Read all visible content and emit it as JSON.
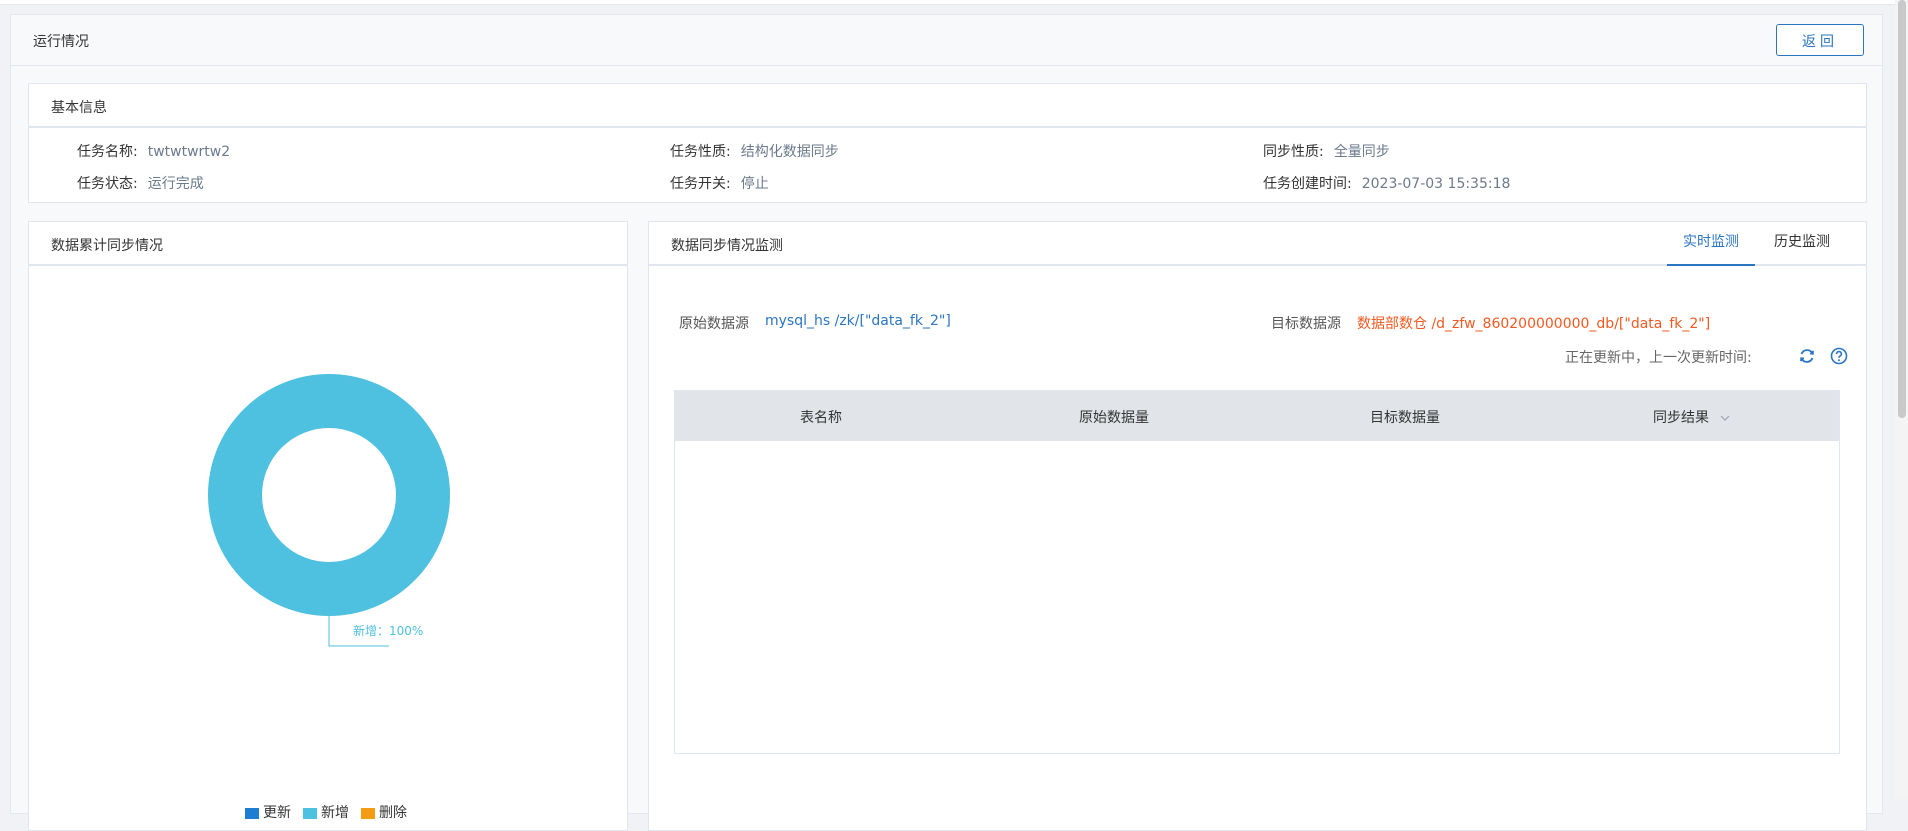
{
  "page": {
    "title": "运行情况",
    "back_label": "返回"
  },
  "basic_info": {
    "title": "基本信息",
    "fields": [
      {
        "label": "任务名称:",
        "value": "twtwtwrtw2"
      },
      {
        "label": "任务性质:",
        "value": "结构化数据同步"
      },
      {
        "label": "同步性质:",
        "value": "全量同步"
      },
      {
        "label": "任务状态:",
        "value": "运行完成"
      },
      {
        "label": "任务开关:",
        "value": "停止"
      },
      {
        "label": "任务创建时间:",
        "value": "2023-07-03 15:35:18"
      }
    ]
  },
  "left_panel": {
    "title": "数据累计同步情况"
  },
  "chart_data": {
    "type": "pie",
    "categories": [
      "更新",
      "新增",
      "删除"
    ],
    "values": [
      0,
      100,
      0
    ],
    "colors": [
      "#1f7dd1",
      "#4ec0e0",
      "#f59b14"
    ],
    "data_label": "新增：100%",
    "legend_position": "bottom"
  },
  "right_panel": {
    "title": "数据同步情况监测",
    "tabs": [
      {
        "label": "实时监测",
        "active": true
      },
      {
        "label": "历史监测",
        "active": false
      }
    ],
    "source_label": "原始数据源",
    "source_value": "mysql_hs /zk/[\"data_fk_2\"]",
    "target_label": "目标数据源",
    "target_value": "数据部数仓 /d_zfw_860200000000_db/[\"data_fk_2\"]",
    "update_text": "正在更新中，上一次更新时间:",
    "refresh_icon": "refresh-icon",
    "help_icon": "help-icon",
    "table": {
      "headers": [
        "表名称",
        "原始数据量",
        "目标数据量",
        "同步结果"
      ],
      "rows": []
    }
  },
  "colors": {
    "accent": "#2b75c2",
    "target_text": "#f05a22"
  }
}
